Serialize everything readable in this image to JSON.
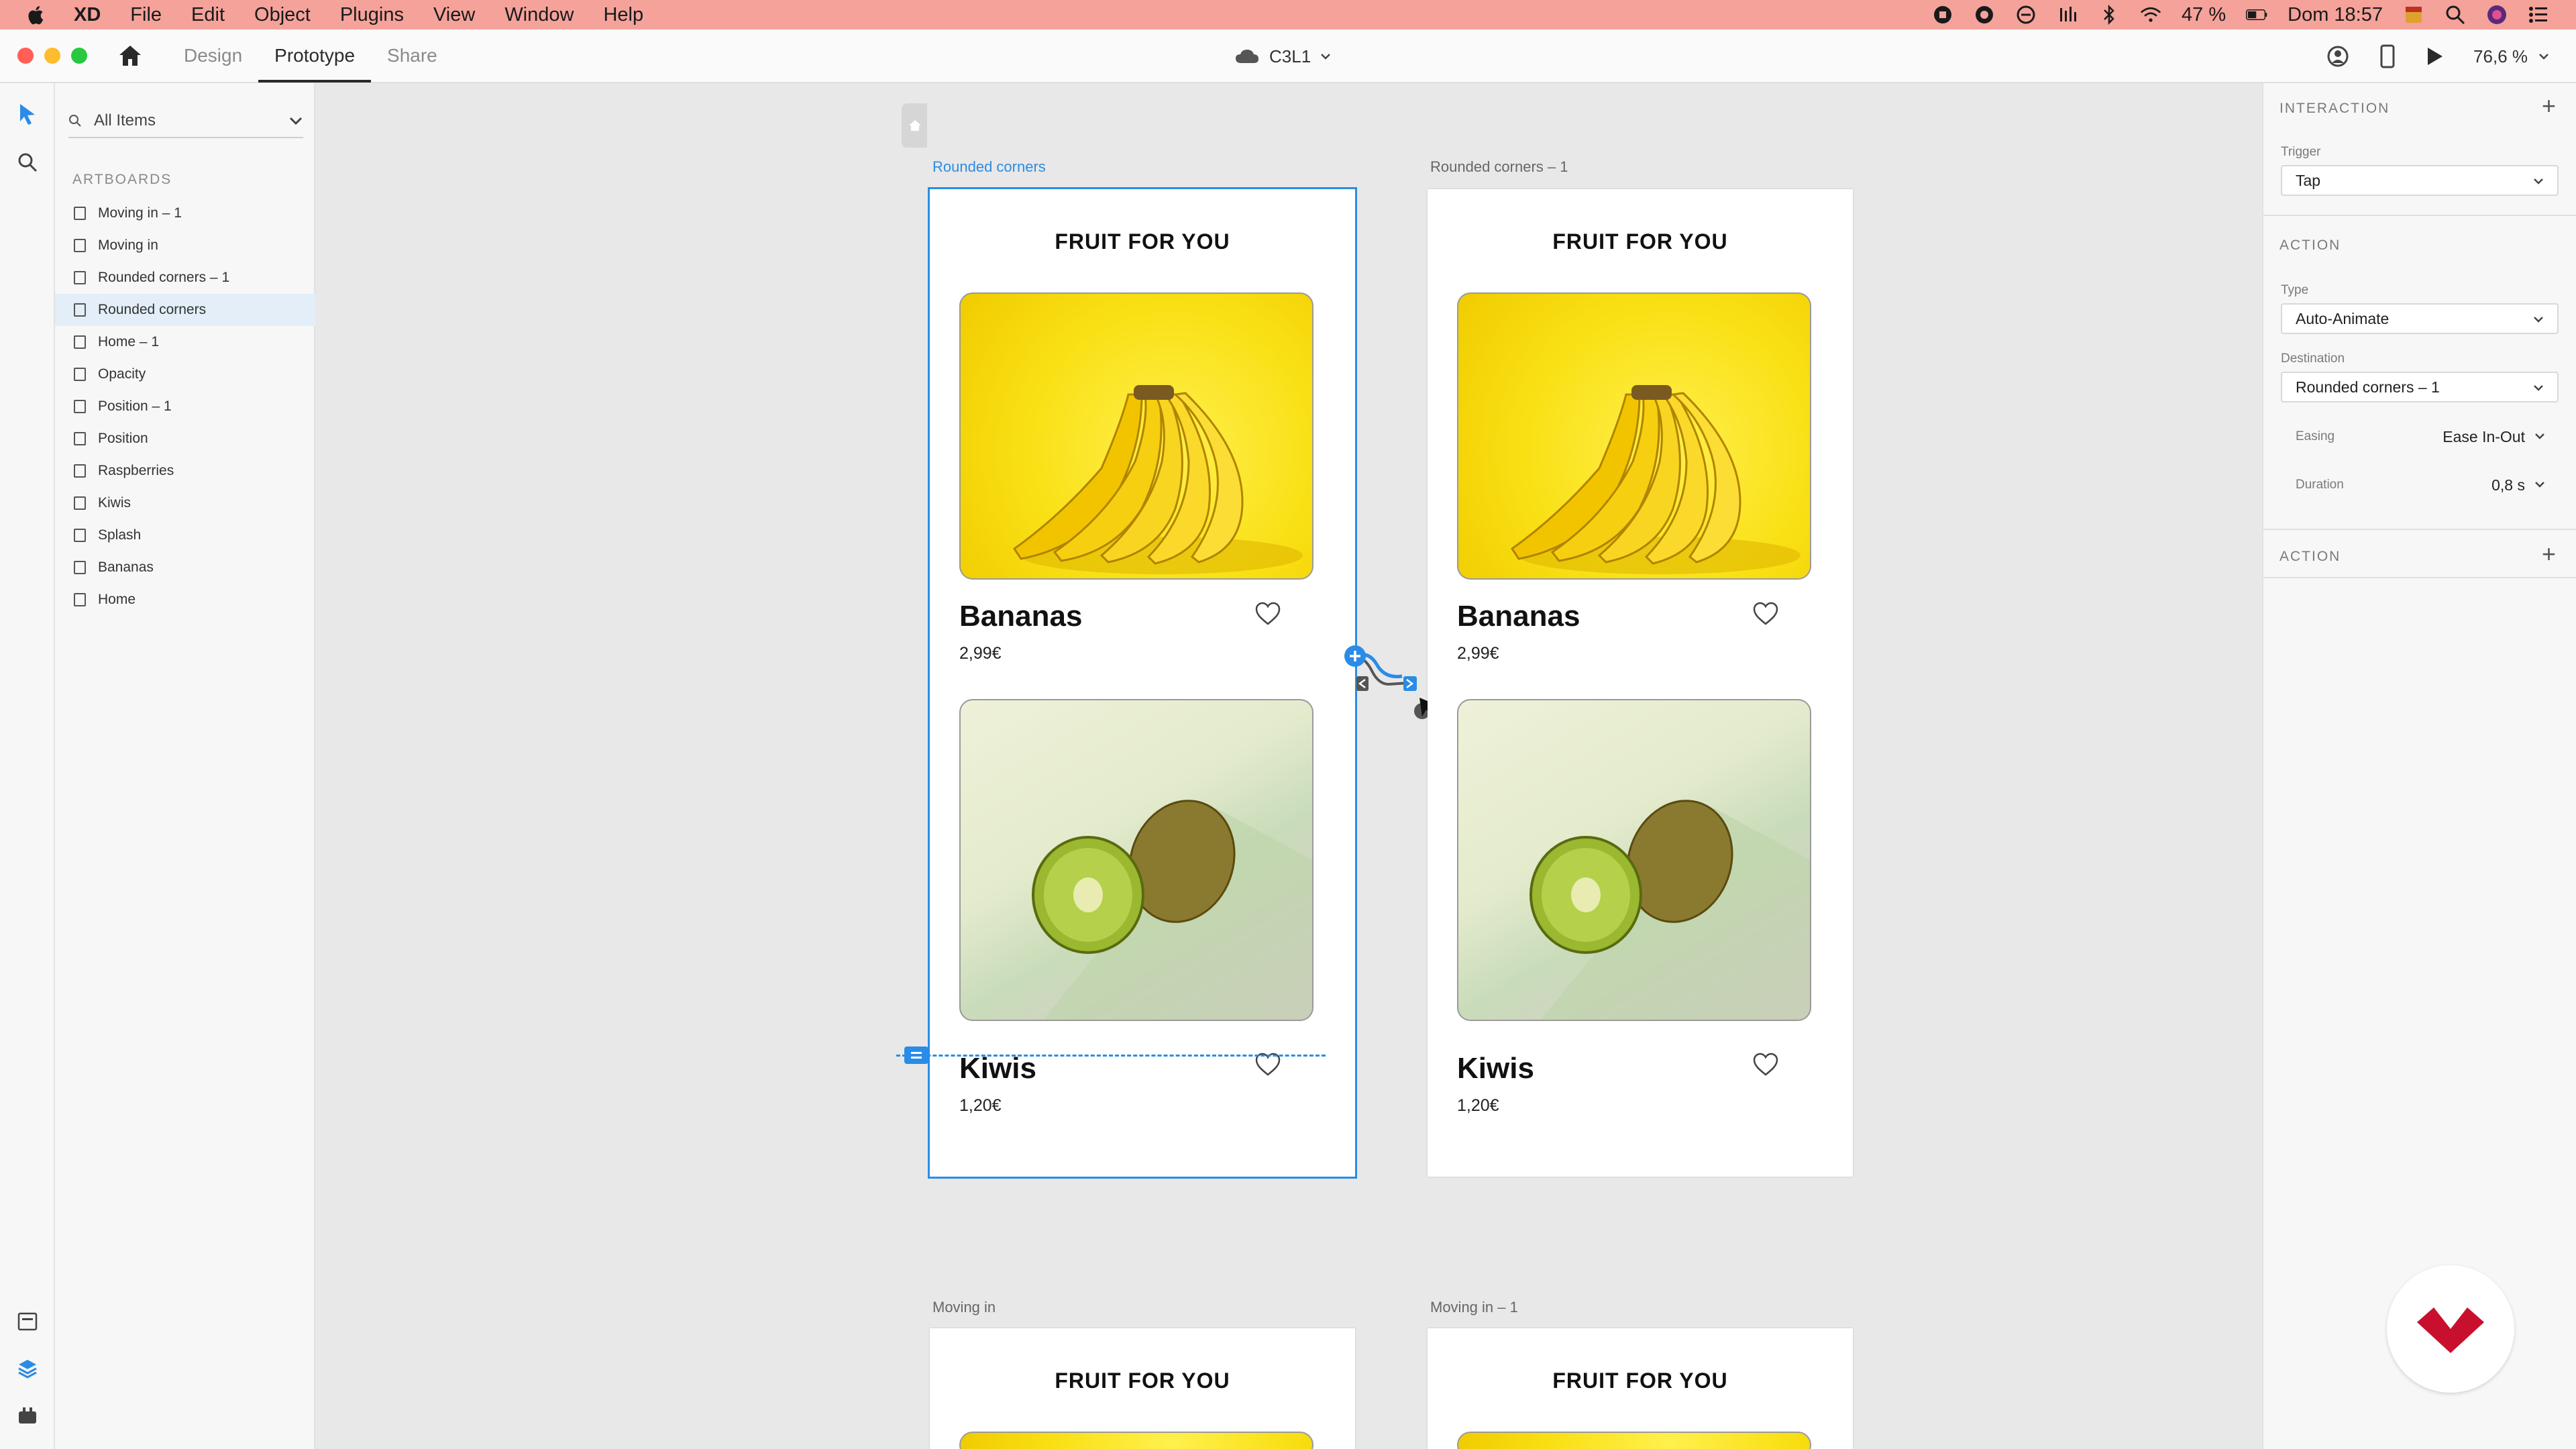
{
  "menubar": {
    "app": "XD",
    "items": [
      "File",
      "Edit",
      "Object",
      "Plugins",
      "View",
      "Window",
      "Help"
    ],
    "battery": "47 %",
    "clock": "Dom 18:57"
  },
  "titlebar": {
    "tabs": [
      "Design",
      "Prototype",
      "Share"
    ],
    "active_tab": "Prototype",
    "doc_title": "C3L1",
    "zoom": "76,6 %"
  },
  "layers": {
    "search_placeholder": "All Items",
    "section_label": "ARTBOARDS",
    "items": [
      "Moving in – 1",
      "Moving in",
      "Rounded corners – 1",
      "Rounded corners",
      "Home – 1",
      "Opacity",
      "Position – 1",
      "Position",
      "Raspberries",
      "Kiwis",
      "Splash",
      "Bananas",
      "Home"
    ],
    "selected": "Rounded corners"
  },
  "canvas": {
    "artboards": {
      "a1": {
        "label": "Rounded corners",
        "title": "FRUIT FOR YOU",
        "p1_name": "Bananas",
        "p1_price": "2,99€",
        "p2_name": "Kiwis",
        "p2_price": "1,20€"
      },
      "a2": {
        "label": "Rounded corners – 1",
        "title": "FRUIT FOR YOU",
        "p1_name": "Bananas",
        "p1_price": "2,99€",
        "p2_name": "Kiwis",
        "p2_price": "1,20€"
      },
      "a3": {
        "label": "Moving in",
        "title": "FRUIT FOR YOU"
      },
      "a4": {
        "label": "Moving in – 1",
        "title": "FRUIT FOR YOU"
      }
    }
  },
  "inspector": {
    "interaction_head": "INTERACTION",
    "trigger_label": "Trigger",
    "trigger_value": "Tap",
    "action_head": "ACTION",
    "type_label": "Type",
    "type_value": "Auto-Animate",
    "destination_label": "Destination",
    "destination_value": "Rounded corners – 1",
    "easing_label": "Easing",
    "easing_value": "Ease In-Out",
    "duration_label": "Duration",
    "duration_value": "0,8 s",
    "action2_head": "ACTION"
  },
  "colors": {
    "accent": "#2a8ce6",
    "menubar": "#f4a29a",
    "badge": "#c8102e"
  }
}
